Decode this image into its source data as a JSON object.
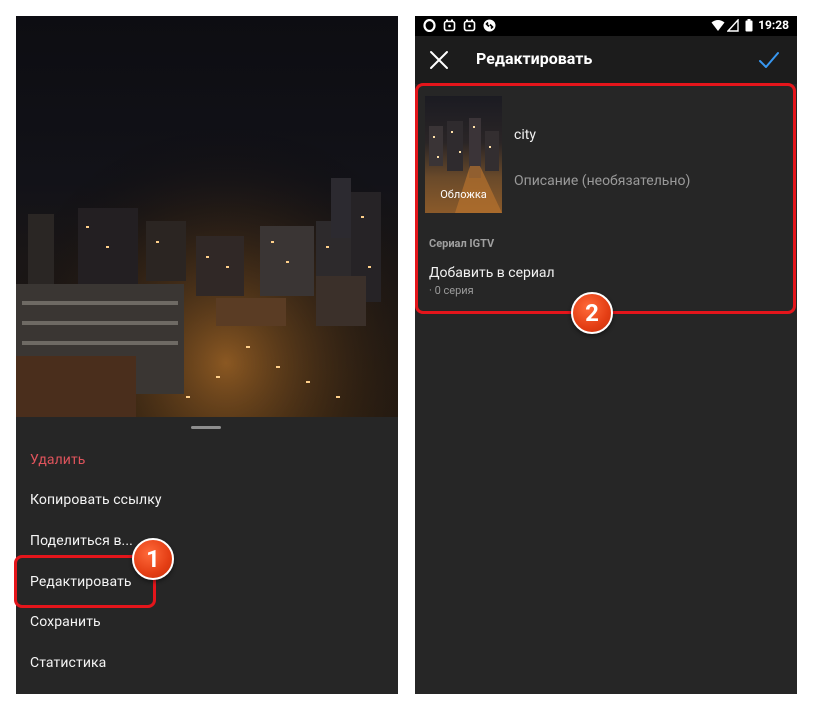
{
  "left_screen": {
    "menu": [
      {
        "label": "Удалить",
        "danger": true
      },
      {
        "label": "Копировать ссылку"
      },
      {
        "label": "Поделиться в..."
      },
      {
        "label": "Редактировать"
      },
      {
        "label": "Сохранить"
      },
      {
        "label": "Статистика"
      }
    ]
  },
  "right_screen": {
    "status_bar": {
      "time": "19:28"
    },
    "header": {
      "title": "Редактировать"
    },
    "cover_label": "Обложка",
    "title_value": "city",
    "description_placeholder": "Описание (необязательно)",
    "series": {
      "heading": "Сериал IGTV",
      "add_label": "Добавить в сериал",
      "count_label": "· 0 серия"
    }
  },
  "annotations": {
    "badge_1": "1",
    "badge_2": "2"
  },
  "colors": {
    "danger": "#e0545c",
    "highlight": "#e4151b",
    "accent": "#3897f0"
  }
}
